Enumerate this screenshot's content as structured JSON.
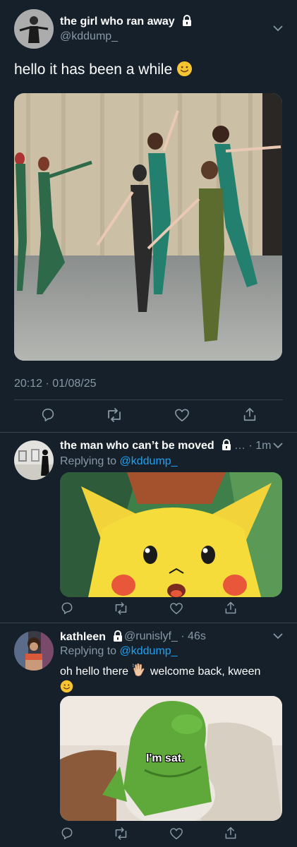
{
  "main_tweet": {
    "display_name": "the girl who ran away",
    "handle": "@kddump_",
    "text": "hello it has been a while",
    "timestamp": "20:12 · 01/08/25"
  },
  "reply1": {
    "display_name": "the man who can’t be moved",
    "meta": "… · 1m",
    "replying_label": "Replying to",
    "replying_handle": "@kddump_"
  },
  "reply2": {
    "display_name": "kathleen",
    "meta": "@runislyf_ · 46s",
    "replying_label": "Replying to",
    "replying_handle": "@kddump_",
    "text_part1": "oh hello there",
    "text_part2": "welcome back, kween",
    "image_caption": "I'm sat."
  },
  "icons": [
    "lock-icon",
    "chevron-down-icon",
    "reply-icon",
    "retweet-icon",
    "like-icon",
    "share-icon",
    "smile-emoji",
    "waving-hand-emoji"
  ],
  "colors": {
    "background": "#15202b",
    "muted": "#8899a6",
    "link": "#1da1f2",
    "divider": "#38444d"
  }
}
